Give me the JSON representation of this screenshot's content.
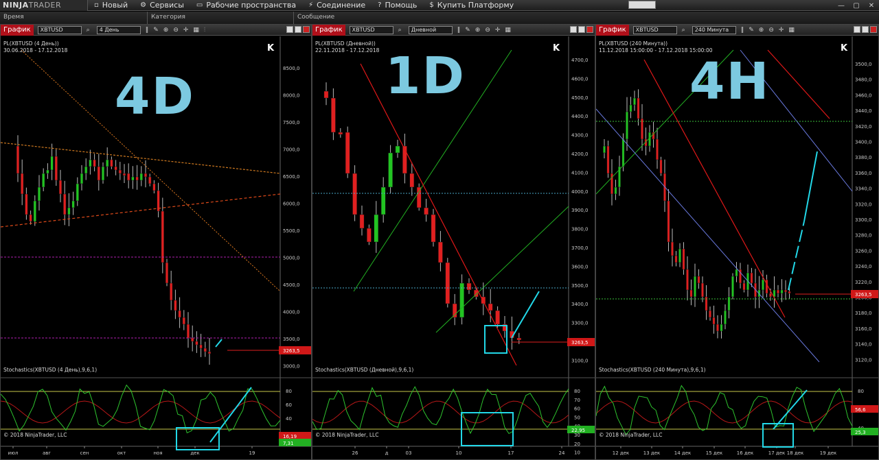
{
  "app": {
    "logo_a": "NINJA",
    "logo_b": "TRADER",
    "menu": [
      {
        "icon": "new-icon",
        "label": "Новый"
      },
      {
        "icon": "services-icon",
        "label": "Сервисы"
      },
      {
        "icon": "workspace-icon",
        "label": "Рабочие пространства"
      },
      {
        "icon": "connection-icon",
        "label": "Соединение"
      },
      {
        "icon": "help-icon",
        "label": "Помощь"
      },
      {
        "icon": "dollar-icon",
        "label": "Купить Платформу"
      }
    ]
  },
  "log": {
    "col_time": "Время",
    "col_category": "Категория",
    "col_message": "Сообщение"
  },
  "panels": [
    {
      "tab": "График",
      "symbol": "XBTUSD",
      "period": "4 День",
      "overlay": "4D",
      "title": "PL(XBTUSD (4 День))",
      "range": "30.06.2018 - 17.12.2018",
      "osc_title": "Stochastics(XBTUSD (4 День),9,6,1)",
      "copyright": "© 2018 NinjaTrader, LLC",
      "last_price": "3263,5",
      "stoch_values": [
        "16,19",
        "7,31"
      ],
      "price_ticks": [
        "8500,0",
        "8000,0",
        "7500,0",
        "7000,0",
        "6500,0",
        "6000,0",
        "5500,0",
        "5000,0",
        "4500,0",
        "4000,0",
        "3500,0",
        "3000,0"
      ],
      "osc_ticks": [
        "80",
        "60",
        "40"
      ],
      "x_ticks": [
        "июл",
        "авг",
        "сен",
        "окт",
        "ноя",
        "дек",
        "19"
      ]
    },
    {
      "tab": "График",
      "symbol": "XBTUSD",
      "period": "Дневной",
      "overlay": "1D",
      "title": "PL(XBTUSD (Дневной))",
      "range": "22.11.2018 - 17.12.2018",
      "osc_title": "Stochastics(XBTUSD (Дневной),9,6,1)",
      "copyright": "© 2018 NinjaTrader, LLC",
      "last_price": "3263,5",
      "stoch_values": [
        "22,95"
      ],
      "price_ticks": [
        "4700,0",
        "4600,0",
        "4500,0",
        "4400,0",
        "4300,0",
        "4200,0",
        "4100,0",
        "4000,0",
        "3900,0",
        "3800,0",
        "3700,0",
        "3600,0",
        "3500,0",
        "3400,0",
        "3300,0",
        "3200,0",
        "3100,0"
      ],
      "osc_ticks": [
        "80",
        "70",
        "60",
        "50",
        "40",
        "30",
        "20",
        "10"
      ],
      "x_ticks": [
        "26",
        "д",
        "03",
        "10",
        "17",
        "24"
      ]
    },
    {
      "tab": "График",
      "symbol": "XBTUSD",
      "period": "240 Минута",
      "overlay": "4H",
      "title": "PL(XBTUSD (240 Минута))",
      "range": "11.12.2018 15:00:00 - 17.12.2018 15:00:00",
      "osc_title": "Stochastics(XBTUSD (240 Минута),9,6,1)",
      "copyright": "© 2018 NinjaTrader, LLC",
      "last_price": "3263,5",
      "stoch_values": [
        "56,6",
        "25,3"
      ],
      "price_ticks": [
        "3500,0",
        "3480,0",
        "3460,0",
        "3440,0",
        "3420,0",
        "3400,0",
        "3380,0",
        "3360,0",
        "3340,0",
        "3320,0",
        "3300,0",
        "3280,0",
        "3260,0",
        "3240,0",
        "3220,0",
        "3200,0",
        "3180,0",
        "3160,0",
        "3140,0",
        "3120,0"
      ],
      "osc_ticks": [
        "80",
        "60",
        "40"
      ],
      "x_ticks": [
        "12 дек",
        "13 дек",
        "14 дек",
        "15 дек",
        "16 дек",
        "17 дек",
        "18 дек",
        "19 дек"
      ]
    }
  ],
  "colors": {
    "up": "#22c422",
    "down": "#e02020",
    "arrow": "#22d8e8",
    "label": "#7cc9e0"
  }
}
